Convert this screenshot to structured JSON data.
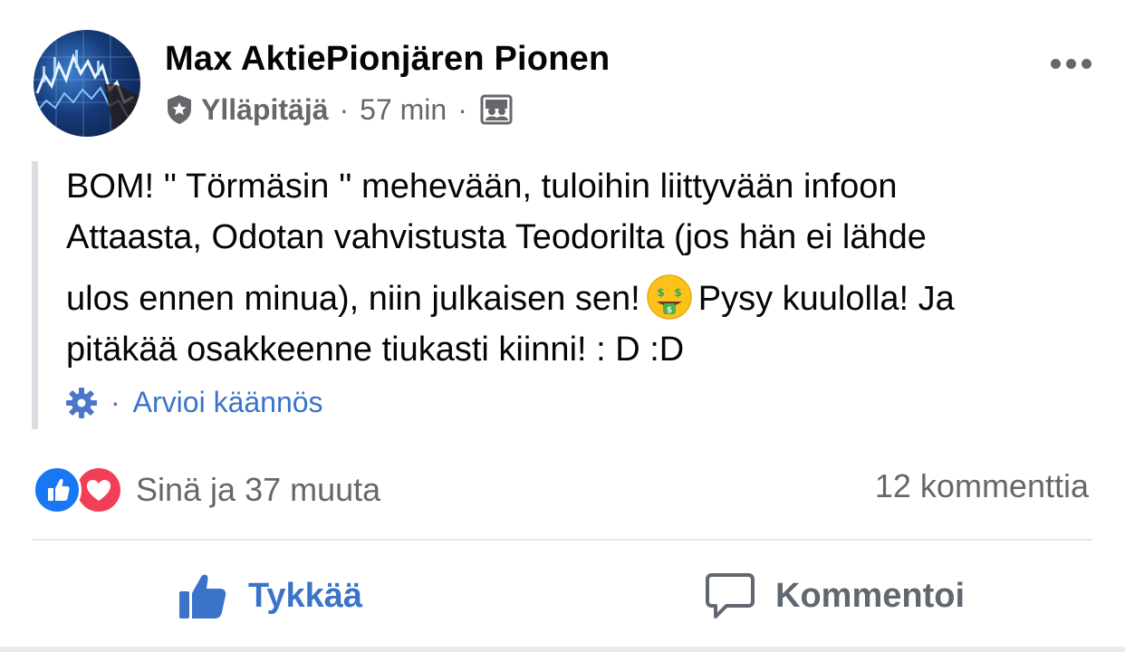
{
  "post": {
    "author": {
      "name": "Max AktiePionjären Pionen",
      "role": "Ylläpitäjä",
      "avatar_icon": "stock-chart-avatar"
    },
    "timestamp": "57 min",
    "separator": "·",
    "audience_icon": "group-photo-icon",
    "more_icon": "more-options-icon",
    "text_lines": [
      "BOM! '' Törmäsin '' mehevään, tuloihin liittyvään infoon",
      "Attaasta, Odotan vahvistusta Teodorilta (jos hän ei lähde",
      "ulos ennen minua), niin julkaisen sen!",
      "Pysy kuulolla! Ja",
      "pitäkää osakkeenne tiukasti kiinni! : D :D"
    ],
    "emoji": "money-mouth-face-emoji",
    "translation": {
      "icon": "gear-icon",
      "dot": "·",
      "link": "Arvioi käännös"
    },
    "reactions": {
      "icons": [
        "like-reaction-icon",
        "love-reaction-icon"
      ],
      "summary": "Sinä ja 37 muuta"
    },
    "comments_count": "12 kommenttia",
    "actions": {
      "like": "Tykkää",
      "comment": "Kommentoi"
    }
  },
  "colors": {
    "link_blue": "#3b73c9",
    "like_blue": "#1877f2",
    "love_red": "#f33e58",
    "secondary_text": "#65676b",
    "divider": "#e4e6eb"
  }
}
